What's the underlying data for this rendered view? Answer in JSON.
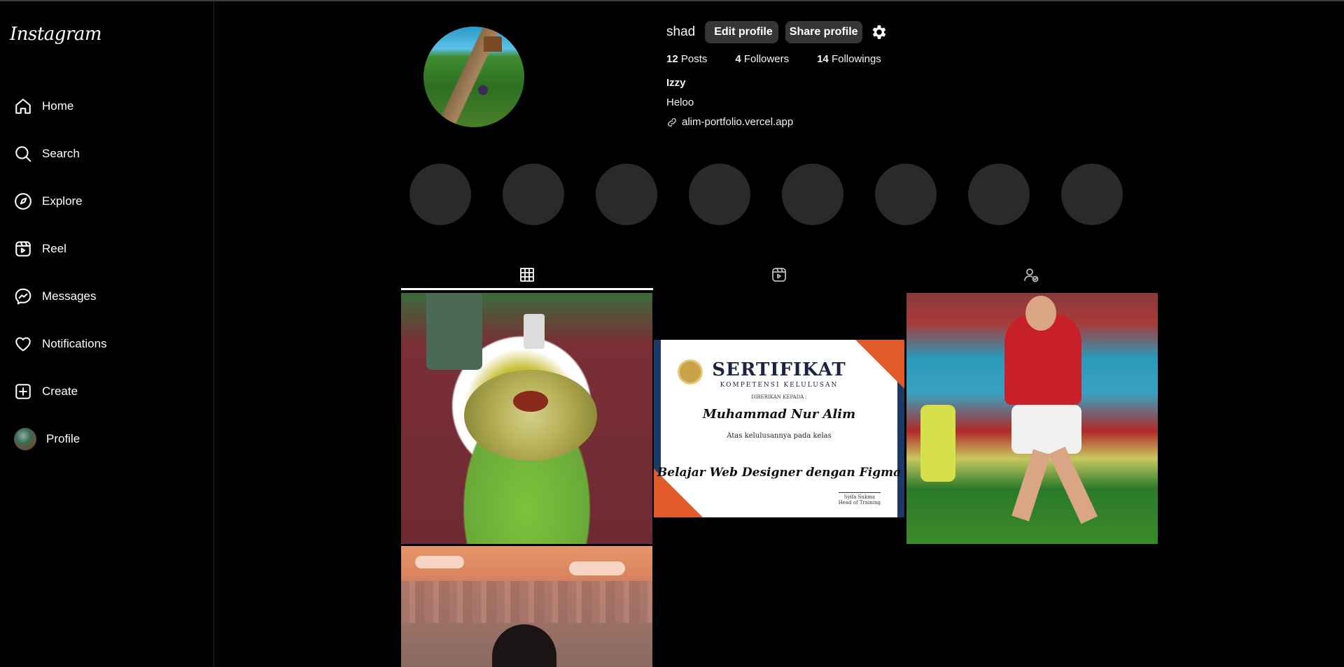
{
  "sidebar": {
    "logo": "Instagram",
    "items": [
      {
        "label": "Home",
        "icon": "home-icon"
      },
      {
        "label": "Search",
        "icon": "search-icon"
      },
      {
        "label": "Explore",
        "icon": "compass-icon"
      },
      {
        "label": "Reel",
        "icon": "reel-icon"
      },
      {
        "label": "Messages",
        "icon": "messenger-icon"
      },
      {
        "label": "Notifications",
        "icon": "heart-icon"
      },
      {
        "label": "Create",
        "icon": "plus-square-icon"
      },
      {
        "label": "Profile",
        "icon": "avatar"
      }
    ]
  },
  "profile": {
    "username": "shad",
    "edit_label": "Edit profile",
    "share_label": "Share profile",
    "stats": {
      "posts": {
        "count": "12",
        "label": "Posts"
      },
      "followers": {
        "count": "4",
        "label": "Followers"
      },
      "following": {
        "count": "14",
        "label": "Followings"
      }
    },
    "full_name": "Izzy",
    "bio": "Heloo",
    "link": "alim-portfolio.vercel.app"
  },
  "tabs": [
    {
      "name": "posts",
      "icon": "grid-icon",
      "active": true
    },
    {
      "name": "reels",
      "icon": "reel-icon",
      "active": false
    },
    {
      "name": "tagged",
      "icon": "tagged-user-icon",
      "active": false
    }
  ],
  "posts": {
    "certificate": {
      "title": "SERTIFIKAT",
      "subtitle": "KOMPETENSI KELULUSAN",
      "given_to": "DIBERIKAN KEPADA :",
      "name": "Muhammad Nur Alim",
      "for_text": "Atas kelulusannya pada kelas",
      "course": "Belajar Web Designer dengan Figma",
      "signer": "Syifa Sukma",
      "signer_role": "Head of Training"
    }
  }
}
